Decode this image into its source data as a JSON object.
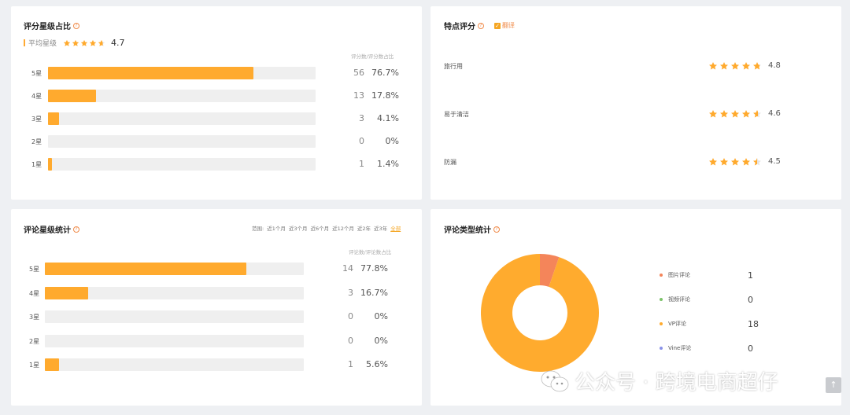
{
  "rating_share": {
    "title": "评分星级占比",
    "avg_label": "平均星级",
    "avg_value": "4.7",
    "avg_stars": 4.7,
    "col_header": "评分数/评分数占比",
    "rows": [
      {
        "label": "5星",
        "count": "56",
        "pct": "76.7%",
        "fraction": 0.767
      },
      {
        "label": "4星",
        "count": "13",
        "pct": "17.8%",
        "fraction": 0.178
      },
      {
        "label": "3星",
        "count": "3",
        "pct": "4.1%",
        "fraction": 0.041
      },
      {
        "label": "2星",
        "count": "0",
        "pct": "0%",
        "fraction": 0
      },
      {
        "label": "1星",
        "count": "1",
        "pct": "1.4%",
        "fraction": 0.014
      }
    ]
  },
  "feature_rating": {
    "title": "特点评分",
    "translate_label": "翻译",
    "translate_checked": true,
    "items": [
      {
        "name": "旅行用",
        "value": "4.8",
        "stars": 4.8
      },
      {
        "name": "易于清洁",
        "value": "4.6",
        "stars": 4.6
      },
      {
        "name": "防漏",
        "value": "4.5",
        "stars": 4.5
      }
    ]
  },
  "review_stats": {
    "title": "评论星级统计",
    "filter_label": "范围:",
    "filters": [
      "近1个月",
      "近3个月",
      "近6个月",
      "近12个月",
      "近2年",
      "近3年",
      "全部"
    ],
    "active_filter": "全部",
    "col_header": "评论数/评论数占比",
    "rows": [
      {
        "label": "5星",
        "count": "14",
        "pct": "77.8%",
        "fraction": 0.778
      },
      {
        "label": "4星",
        "count": "3",
        "pct": "16.7%",
        "fraction": 0.167
      },
      {
        "label": "3星",
        "count": "0",
        "pct": "0%",
        "fraction": 0
      },
      {
        "label": "2星",
        "count": "0",
        "pct": "0%",
        "fraction": 0
      },
      {
        "label": "1星",
        "count": "1",
        "pct": "5.6%",
        "fraction": 0.056
      }
    ]
  },
  "review_type": {
    "title": "评论类型统计",
    "legend": [
      {
        "name": "图片评论",
        "value": "1",
        "color": "#f4855a"
      },
      {
        "name": "视频评论",
        "value": "0",
        "color": "#7cc36a"
      },
      {
        "name": "VP评论",
        "value": "18",
        "color": "#ffab2e"
      },
      {
        "name": "Vine评论",
        "value": "0",
        "color": "#8a92e8"
      }
    ]
  },
  "chart_data": {
    "type": "pie",
    "categories": [
      "图片评论",
      "视频评论",
      "VP评论",
      "Vine评论"
    ],
    "values": [
      1,
      0,
      18,
      0
    ]
  },
  "colors": {
    "accent": "#ffaa2e",
    "track": "#efefef",
    "icon": "#f08c4b"
  },
  "watermark": "公众号 · 跨境电商超仔",
  "scroll_top_icon": "arrow-up-icon"
}
